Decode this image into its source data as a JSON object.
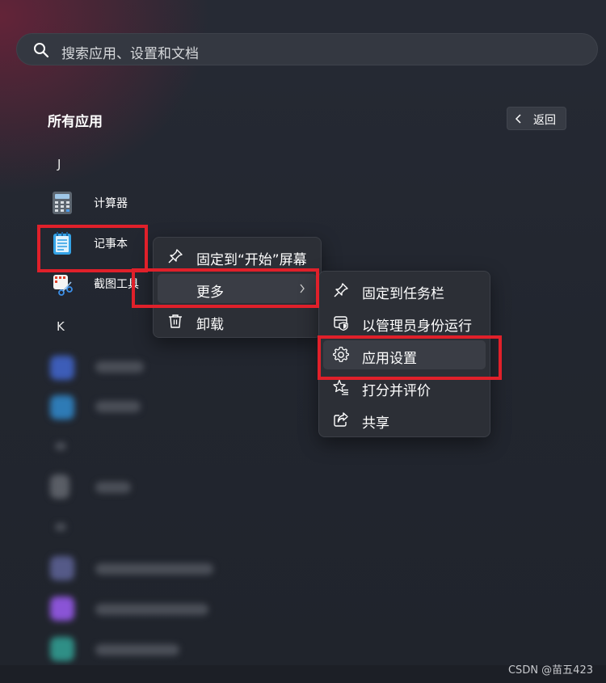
{
  "search": {
    "placeholder": "搜索应用、设置和文档",
    "icon": "search-icon"
  },
  "all_apps": {
    "title": "所有应用",
    "back_label": "返回"
  },
  "groups": [
    {
      "letter": "J",
      "apps": [
        "计算器",
        "记事本",
        "截图工具"
      ]
    },
    {
      "letter": "K"
    }
  ],
  "context_menu": {
    "items": [
      {
        "label": "固定到“开始”屏幕",
        "icon": "pin-icon"
      },
      {
        "label": "更多",
        "icon": "",
        "has_submenu": true
      },
      {
        "label": "卸载",
        "icon": "trash-icon"
      }
    ]
  },
  "more_submenu": {
    "items": [
      {
        "label": "固定到任务栏",
        "icon": "pin-icon"
      },
      {
        "label": "以管理员身份运行",
        "icon": "admin-shield-icon"
      },
      {
        "label": "应用设置",
        "icon": "gear-icon"
      },
      {
        "label": "打分并评价",
        "icon": "star-rate-icon"
      },
      {
        "label": "共享",
        "icon": "share-icon"
      }
    ]
  },
  "highlight_color": "#e0202a",
  "watermark": "CSDN @苗五423"
}
